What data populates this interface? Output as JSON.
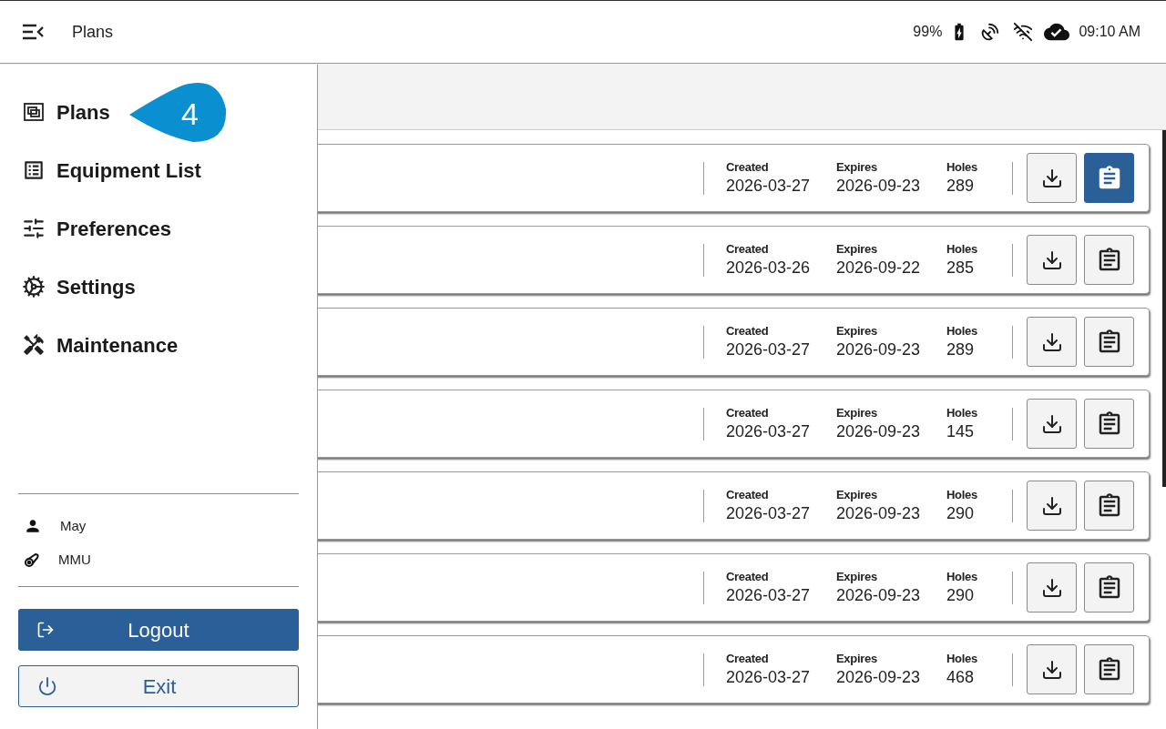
{
  "top_bar": {
    "title": "Plans",
    "battery": "99%",
    "time": "09:10 AM"
  },
  "drawer": {
    "items": [
      {
        "kind": "plans",
        "label": "Plans"
      },
      {
        "kind": "equipment",
        "label": "Equipment List"
      },
      {
        "kind": "preferences",
        "label": "Preferences"
      },
      {
        "kind": "settings",
        "label": "Settings"
      },
      {
        "kind": "maintenance",
        "label": "Maintenance"
      }
    ],
    "callout": "4",
    "user": "May",
    "machine": "MMU",
    "logout": "Logout",
    "exit": "Exit"
  },
  "plans": [
    {
      "created_label": "Created",
      "created": "2026-03-27",
      "expires_label": "Expires",
      "expires": "2026-09-23",
      "holes_label": "Holes",
      "holes": "289",
      "selected": true
    },
    {
      "created_label": "Created",
      "created": "2026-03-26",
      "expires_label": "Expires",
      "expires": "2026-09-22",
      "holes_label": "Holes",
      "holes": "285",
      "selected": false
    },
    {
      "created_label": "Created",
      "created": "2026-03-27",
      "expires_label": "Expires",
      "expires": "2026-09-23",
      "holes_label": "Holes",
      "holes": "289",
      "selected": false
    },
    {
      "created_label": "Created",
      "created": "2026-03-27",
      "expires_label": "Expires",
      "expires": "2026-09-23",
      "holes_label": "Holes",
      "holes": "145",
      "selected": false
    },
    {
      "created_label": "Created",
      "created": "2026-03-27",
      "expires_label": "Expires",
      "expires": "2026-09-23",
      "holes_label": "Holes",
      "holes": "290",
      "selected": false
    },
    {
      "created_label": "Created",
      "created": "2026-03-27",
      "expires_label": "Expires",
      "expires": "2026-09-23",
      "holes_label": "Holes",
      "holes": "290",
      "selected": false
    },
    {
      "created_label": "Created",
      "created": "2026-03-27",
      "expires_label": "Expires",
      "expires": "2026-09-23",
      "holes_label": "Holes",
      "holes": "468",
      "selected": false
    }
  ]
}
